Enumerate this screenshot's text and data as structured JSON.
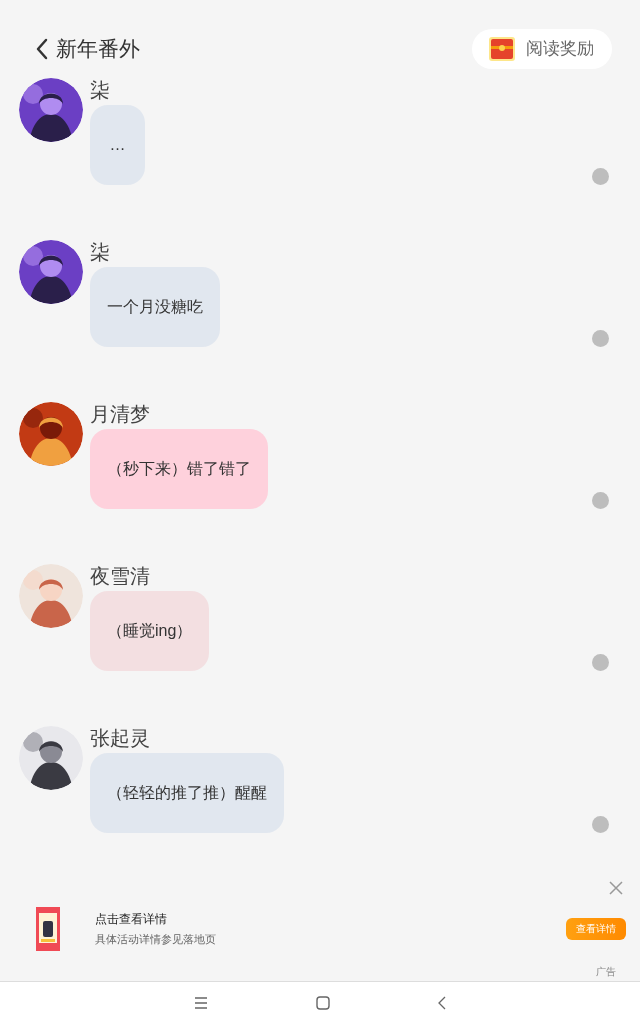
{
  "header": {
    "title": "新年番外",
    "reward_button": "阅读奖励"
  },
  "messages": [
    {
      "name": "柒",
      "text": "…",
      "color": "#e1e7ef"
    },
    {
      "name": "柒",
      "text": "一个月没糖吃",
      "color": "#e1e7ef"
    },
    {
      "name": "月清梦",
      "text": "（秒下来）错了错了",
      "color": "#fed1dc"
    },
    {
      "name": "夜雪清",
      "text": "（睡觉ing）",
      "color": "#f3dfe1"
    },
    {
      "name": "张起灵",
      "text": "（轻轻的推了推）醒醒",
      "color": "#e1e7ef"
    }
  ],
  "ad": {
    "title": "点击查看详情",
    "subtitle": "具体活动详情参见落地页",
    "button": "查看详情",
    "label": "广告"
  }
}
